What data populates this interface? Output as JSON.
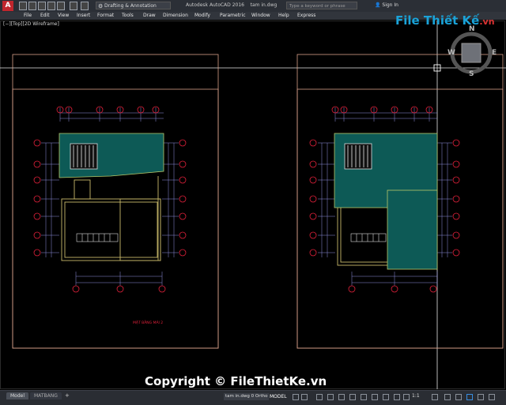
{
  "titlebar": {
    "app_icon": "A",
    "workspace": "Drafting & Annotation",
    "app_title": "Autodesk AutoCAD 2016",
    "file_title": "tam in.dwg",
    "search_placeholder": "Type a keyword or phrase",
    "signin": "Sign In"
  },
  "menu": [
    "File",
    "Edit",
    "View",
    "Insert",
    "Format",
    "Tools",
    "Draw",
    "Dimension",
    "Modify",
    "Parametric",
    "Window",
    "Help",
    "Express"
  ],
  "viewport": {
    "label": "[−][Top][2D Wireframe]"
  },
  "viewcube": {
    "north": "N",
    "south": "S",
    "west": "W",
    "east": "E"
  },
  "watermark": {
    "name": "File Thiết Kế",
    "ext": ".vn"
  },
  "copyright": "Copyright © FileThietKe.vn",
  "drawing": {
    "left_plan_title": "MẶT BẰNG MÁI 2"
  },
  "statusbar": {
    "tabs": [
      "Model",
      "MATBANG"
    ],
    "add_tab": "+",
    "file_status": "tam in.dwg 0 Ortho",
    "model_button": "MODEL",
    "scale": "1:1"
  },
  "colors": {
    "background": "#000000",
    "sheet_border": "#d9a089",
    "roof_fill": "#0d5a56",
    "roof_edge": "#b8c96a",
    "grid_bubble": "#e0203a",
    "dim_line": "#8f8fe0",
    "crosshair": "#e6e6e6"
  }
}
